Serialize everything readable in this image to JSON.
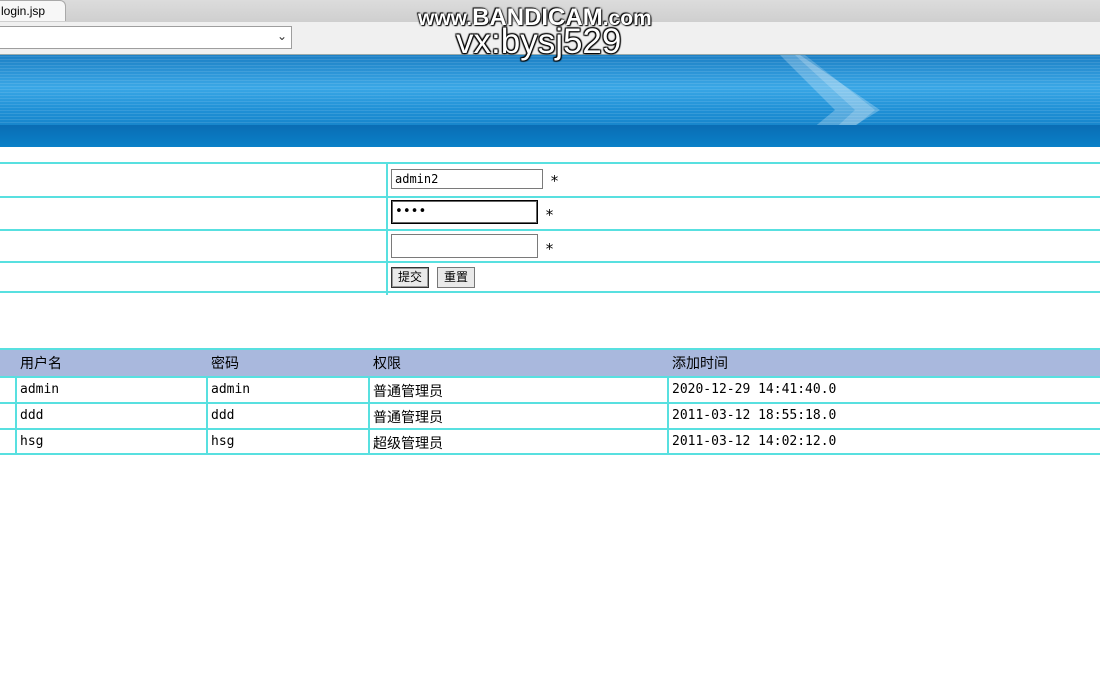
{
  "browser": {
    "tab_title": "login.jsp",
    "address_value": ""
  },
  "watermark": {
    "line1_prefix": "www.",
    "line1_brand": "BANDICAM",
    "line1_suffix": ".com",
    "line2": "vx:bysj529"
  },
  "form": {
    "username_value": "admin2",
    "password_value": "••••",
    "confirm_value": "",
    "required_mark": "*",
    "submit_label": "提交",
    "reset_label": "重置"
  },
  "table": {
    "headers": [
      "用户名",
      "密码",
      "权限",
      "添加时间"
    ],
    "rows": [
      [
        "admin",
        "admin",
        "普通管理员",
        "2020-12-29 14:41:40.0"
      ],
      [
        "ddd",
        "ddd",
        "普通管理员",
        "2011-03-12 18:55:18.0"
      ],
      [
        "hsg",
        "hsg",
        "超级管理员",
        "2011-03-12 14:02:12.0"
      ]
    ]
  },
  "colors": {
    "grid_line": "#58e0e0",
    "header_bg": "#a9b8dd",
    "banner_blue": "#1f90d6"
  },
  "icons": {
    "address_dropdown": "chevron-down-icon",
    "banner_arrow": "arrow-logo-icon"
  }
}
